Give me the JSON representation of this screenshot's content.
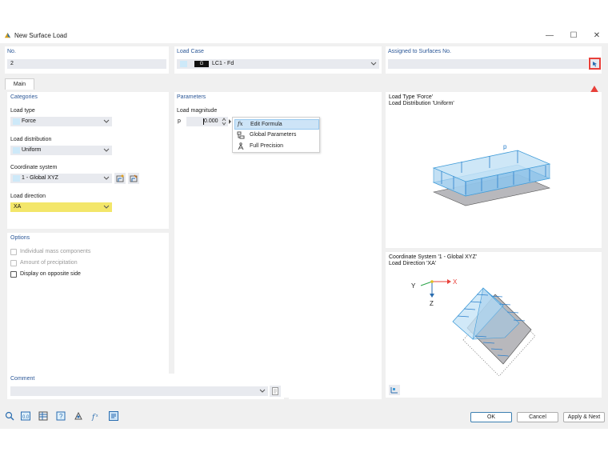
{
  "window": {
    "title": "New Surface Load",
    "minimize_label": "—",
    "maximize_label": "☐",
    "close_label": "✕"
  },
  "header": {
    "no_label": "No.",
    "no_value": "2",
    "load_case_label": "Load Case",
    "load_case_badge": "G",
    "load_case_value": "LC1 - Fd",
    "assigned_label": "Assigned to Surfaces No.",
    "assigned_value": ""
  },
  "tabs": [
    {
      "label": "Main"
    }
  ],
  "categories": {
    "title": "Categories",
    "load_type_label": "Load type",
    "load_type_value": "Force",
    "load_distribution_label": "Load distribution",
    "load_distribution_value": "Uniform",
    "coordinate_system_label": "Coordinate system",
    "coordinate_system_value": "1 - Global XYZ",
    "load_direction_label": "Load direction",
    "load_direction_value": "XA"
  },
  "parameters": {
    "title": "Parameters",
    "load_magnitude_label": "Load magnitude",
    "p_symbol": "p",
    "p_value": "0.000"
  },
  "context_menu": {
    "items": [
      {
        "icon_text": "fx",
        "label": "Edit Formula"
      },
      {
        "icon_text": "",
        "label": "Global Parameters"
      },
      {
        "icon_text": "",
        "label": "Full Precision"
      }
    ]
  },
  "options": {
    "title": "Options",
    "items": [
      {
        "label": "Individual mass components",
        "checked": false,
        "enabled": false
      },
      {
        "label": "Amount of precipitation",
        "checked": false,
        "enabled": false
      },
      {
        "label": "Display on opposite side",
        "checked": false,
        "enabled": true
      }
    ]
  },
  "preview_top": {
    "line1": "Load Type 'Force'",
    "line2": "Load Distribution 'Uniform'",
    "load_symbol": "p"
  },
  "preview_bottom": {
    "line1": "Coordinate System '1 - Global XYZ'",
    "line2": "Load Direction 'XA'",
    "axis_x": "X",
    "axis_y": "Y",
    "axis_z": "Z"
  },
  "comment": {
    "label": "Comment",
    "value": ""
  },
  "footer": {
    "ok_label": "OK",
    "cancel_label": "Cancel",
    "apply_next_label": "Apply & Next"
  },
  "colors": {
    "highlight_yellow": "#f3e66a",
    "section_blue": "#2b5797",
    "red_arrow": "#e8403a",
    "load_blue": "#3f9bd8"
  }
}
